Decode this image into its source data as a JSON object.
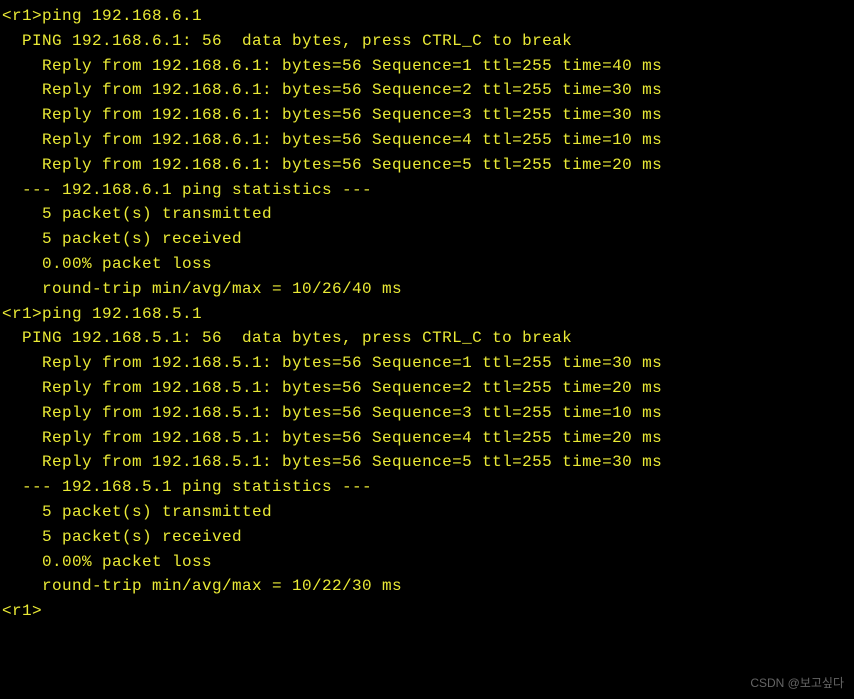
{
  "blocks": [
    {
      "lines": [
        {
          "indent": 0,
          "text": "<r1>ping 192.168.6.1"
        },
        {
          "indent": 2,
          "text": "PING 192.168.6.1: 56  data bytes, press CTRL_C to break"
        },
        {
          "indent": 4,
          "text": "Reply from 192.168.6.1: bytes=56 Sequence=1 ttl=255 time=40 ms"
        },
        {
          "indent": 4,
          "text": "Reply from 192.168.6.1: bytes=56 Sequence=2 ttl=255 time=30 ms"
        },
        {
          "indent": 4,
          "text": "Reply from 192.168.6.1: bytes=56 Sequence=3 ttl=255 time=30 ms"
        },
        {
          "indent": 4,
          "text": "Reply from 192.168.6.1: bytes=56 Sequence=4 ttl=255 time=10 ms"
        },
        {
          "indent": 4,
          "text": "Reply from 192.168.6.1: bytes=56 Sequence=5 ttl=255 time=20 ms"
        },
        {
          "indent": 0,
          "text": ""
        },
        {
          "indent": 2,
          "text": "--- 192.168.6.1 ping statistics ---"
        },
        {
          "indent": 4,
          "text": "5 packet(s) transmitted"
        },
        {
          "indent": 4,
          "text": "5 packet(s) received"
        },
        {
          "indent": 4,
          "text": "0.00% packet loss"
        },
        {
          "indent": 4,
          "text": "round-trip min/avg/max = 10/26/40 ms"
        },
        {
          "indent": 0,
          "text": ""
        }
      ]
    },
    {
      "lines": [
        {
          "indent": 0,
          "text": "<r1>ping 192.168.5.1"
        },
        {
          "indent": 2,
          "text": "PING 192.168.5.1: 56  data bytes, press CTRL_C to break"
        },
        {
          "indent": 4,
          "text": "Reply from 192.168.5.1: bytes=56 Sequence=1 ttl=255 time=30 ms"
        },
        {
          "indent": 4,
          "text": "Reply from 192.168.5.1: bytes=56 Sequence=2 ttl=255 time=20 ms"
        },
        {
          "indent": 4,
          "text": "Reply from 192.168.5.1: bytes=56 Sequence=3 ttl=255 time=10 ms"
        },
        {
          "indent": 4,
          "text": "Reply from 192.168.5.1: bytes=56 Sequence=4 ttl=255 time=20 ms"
        },
        {
          "indent": 4,
          "text": "Reply from 192.168.5.1: bytes=56 Sequence=5 ttl=255 time=30 ms"
        },
        {
          "indent": 0,
          "text": ""
        },
        {
          "indent": 2,
          "text": "--- 192.168.5.1 ping statistics ---"
        },
        {
          "indent": 4,
          "text": "5 packet(s) transmitted"
        },
        {
          "indent": 4,
          "text": "5 packet(s) received"
        },
        {
          "indent": 4,
          "text": "0.00% packet loss"
        },
        {
          "indent": 4,
          "text": "round-trip min/avg/max = 10/22/30 ms"
        },
        {
          "indent": 0,
          "text": ""
        }
      ]
    },
    {
      "lines": [
        {
          "indent": 0,
          "text": "<r1>"
        }
      ]
    }
  ],
  "watermark": "CSDN @보고싶다"
}
